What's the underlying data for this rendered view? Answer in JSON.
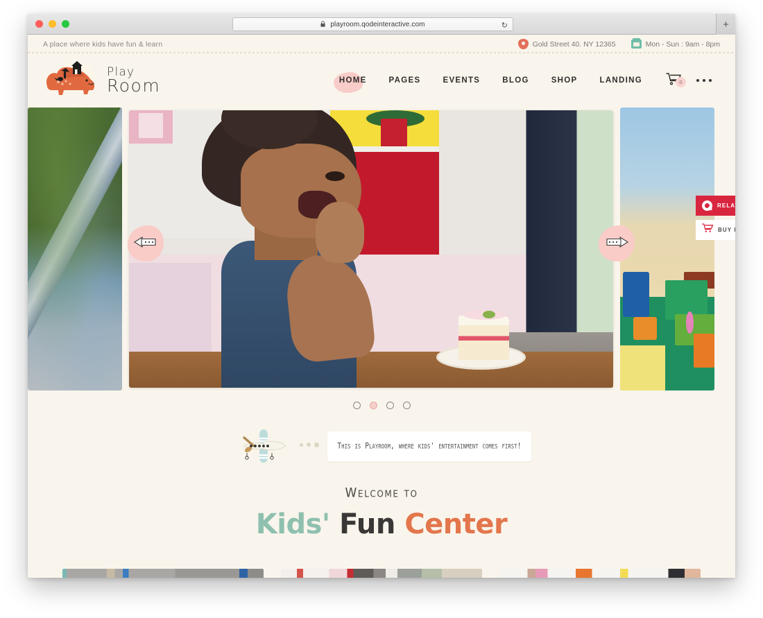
{
  "browser": {
    "url": "playroom.qodeinteractive.com",
    "lock_icon": "lock-icon",
    "reload_icon": "reload-icon",
    "new_tab_label": "+",
    "traffic_lights": [
      "close",
      "minimize",
      "maximize"
    ]
  },
  "top_bar": {
    "tagline": "A place where kids have fun & learn",
    "address": "Gold Street 40. NY 12365",
    "address_icon": "map-pin-icon",
    "hours": "Mon - Sun : 9am - 8pm",
    "hours_icon": "clock-icon"
  },
  "logo": {
    "line1": "Play",
    "line2": "Room",
    "mark_icon": "dinosaur-logo-icon"
  },
  "nav": {
    "items": [
      {
        "label": "HOME",
        "active": true
      },
      {
        "label": "PAGES",
        "active": false
      },
      {
        "label": "EVENTS",
        "active": false
      },
      {
        "label": "BLOG",
        "active": false
      },
      {
        "label": "SHOP",
        "active": false
      },
      {
        "label": "LANDING",
        "active": false
      }
    ],
    "cart_icon": "shopping-cart-icon",
    "cart_count": "0",
    "more_icon": "more-dots-icon"
  },
  "slider": {
    "prev_label": "prev-slide",
    "next_label": "next-slide",
    "prev_icon": "arrow-left-icon",
    "next_icon": "arrow-right-icon",
    "slides": [
      {
        "name": "rope-playground",
        "alt": "Climbing rope on green background"
      },
      {
        "name": "child-eating-cake",
        "alt": "Child sitting at table eating slice of cake"
      },
      {
        "name": "lego-bricks",
        "alt": "Colorful lego bricks on green base plate"
      }
    ],
    "dots": [
      {
        "index": 1,
        "active": false
      },
      {
        "index": 2,
        "active": true
      },
      {
        "index": 3,
        "active": false
      },
      {
        "index": 4,
        "active": false
      }
    ]
  },
  "product_actions": {
    "related_label": "RELATED",
    "related_icon": "magnifier-icon",
    "buy_label": "BUY NOW",
    "buy_icon": "cart-icon"
  },
  "caption": {
    "text": "This is Playroom, where kids' entertainment comes first!",
    "plane_icon": "airplane-icon",
    "trail_icon": "dots-trail-icon"
  },
  "welcome": {
    "small": "Welcome to",
    "word1": "Kids'",
    "word2": "Fun",
    "word3": "Center"
  },
  "cards": [
    {
      "name": "card-climbing-wall",
      "alt": "Kids climbing wall"
    },
    {
      "name": "card-playroom-interior",
      "alt": "Playroom interior"
    },
    {
      "name": "card-birthday-party",
      "alt": "Children with party hats"
    }
  ],
  "colors": {
    "page_bg": "#f9f5ec",
    "accent_pink": "#f8ccc9",
    "accent_orange": "#e3764c",
    "accent_teal": "#8fc0af",
    "accent_red": "#d9263f",
    "text_dark": "#2f2d2b"
  }
}
